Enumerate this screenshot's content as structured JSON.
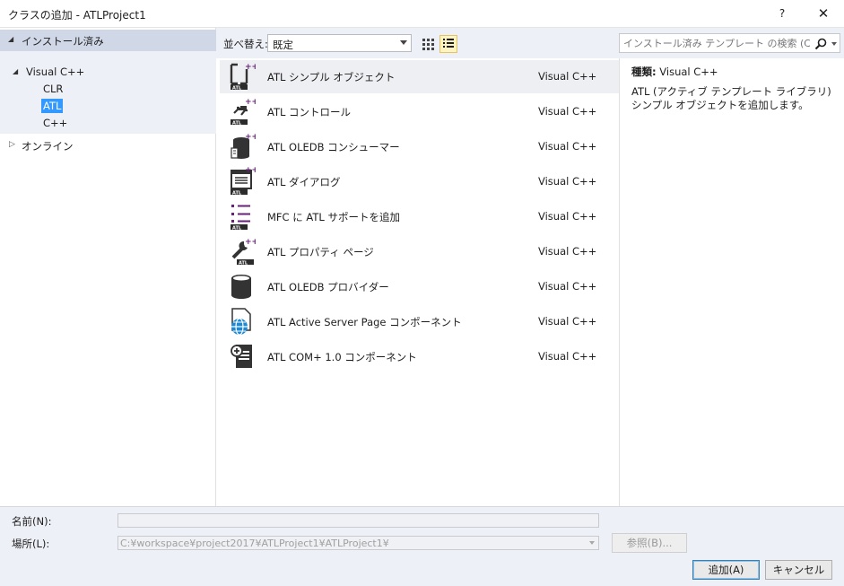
{
  "window": {
    "title": "クラスの追加 - ATLProject1",
    "help_label": "?",
    "close_label": "✕"
  },
  "tree": {
    "installed": "インストール済み",
    "visual_cpp": "Visual C++",
    "items": [
      "CLR",
      "ATL",
      "C++"
    ],
    "selected": "ATL",
    "online": "オンライン"
  },
  "toolbar": {
    "sort_label": "並べ替え:",
    "sort_value": "既定",
    "search_placeholder": "インストール済み テンプレート の検索 (Ctrl+E)"
  },
  "templates": [
    {
      "name": "ATL シンプル オブジェクト",
      "lang": "Visual C++",
      "icon": "atl-simple-object-icon"
    },
    {
      "name": "ATL コントロール",
      "lang": "Visual C++",
      "icon": "atl-control-icon"
    },
    {
      "name": "ATL OLEDB コンシューマー",
      "lang": "Visual C++",
      "icon": "atl-oledb-consumer-icon"
    },
    {
      "name": "ATL ダイアログ",
      "lang": "Visual C++",
      "icon": "atl-dialog-icon"
    },
    {
      "name": "MFC に ATL サポートを追加",
      "lang": "Visual C++",
      "icon": "mfc-atl-support-icon"
    },
    {
      "name": "ATL プロパティ ページ",
      "lang": "Visual C++",
      "icon": "atl-property-page-icon"
    },
    {
      "name": "ATL OLEDB プロバイダー",
      "lang": "Visual C++",
      "icon": "atl-oledb-provider-icon"
    },
    {
      "name": "ATL Active Server Page コンポーネント",
      "lang": "Visual C++",
      "icon": "atl-asp-component-icon"
    },
    {
      "name": "ATL COM+ 1.0 コンポーネント",
      "lang": "Visual C++",
      "icon": "atl-complus-component-icon"
    }
  ],
  "detail": {
    "type_key": "種類:",
    "type_value": "Visual C++",
    "description": "ATL (アクティブ テンプレート ライブラリ) シンプル オブジェクトを追加します。"
  },
  "form": {
    "name_label": "名前(N):",
    "name_value": "",
    "location_label": "場所(L):",
    "location_value": "C:¥workspace¥project2017¥ATLProject1¥ATLProject1¥",
    "browse_label": "参照(B)...",
    "add_label": "追加(A)",
    "cancel_label": "キャンセル"
  },
  "colors": {
    "accent": "#3399ff",
    "purple": "#68217a",
    "panel": "#eef0f7"
  }
}
